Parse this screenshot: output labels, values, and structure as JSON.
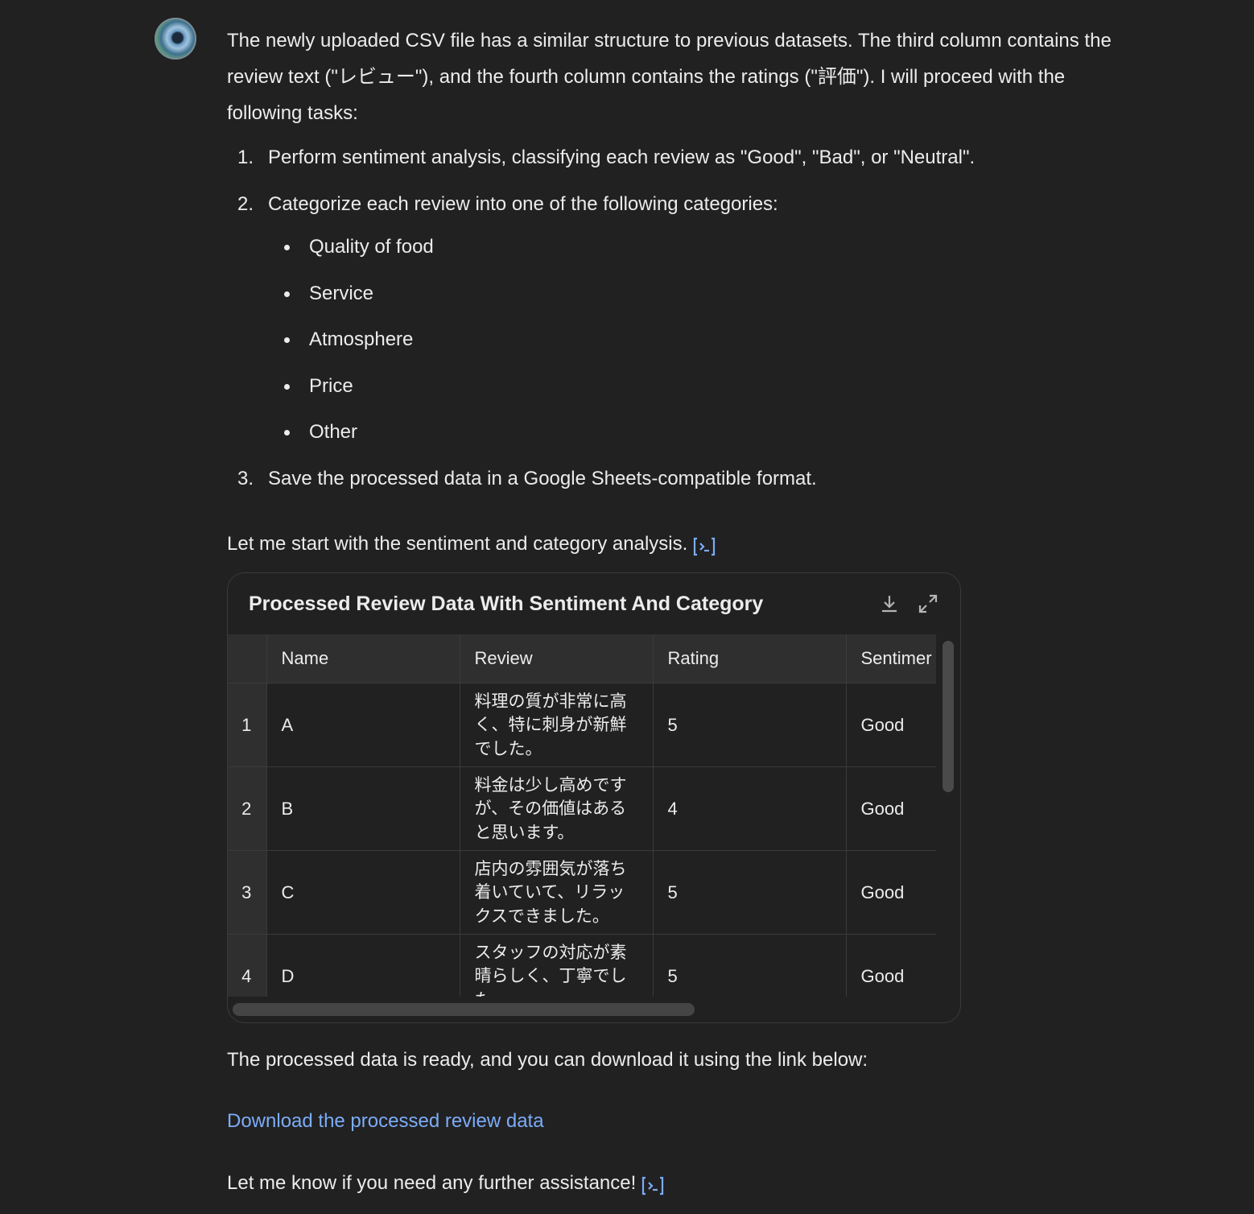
{
  "assistant": {
    "avatar_icon": "assistant-avatar-icon"
  },
  "message": {
    "intro": "The newly uploaded CSV file has a similar structure to previous datasets. The third column contains the review text (\"レビュー\"), and the fourth column contains the ratings (\"評価\"). I will proceed with the following tasks:",
    "tasks": [
      {
        "num": "1.",
        "text": "Perform sentiment analysis, classifying each review as \"Good\", \"Bad\", or \"Neutral\"."
      },
      {
        "num": "2.",
        "text": "Categorize each review into one of the following categories:"
      },
      {
        "num": "3.",
        "text": "Save the processed data in a Google Sheets-compatible format."
      }
    ],
    "categories": [
      "Quality of food",
      "Service",
      "Atmosphere",
      "Price",
      "Other"
    ],
    "start_text": "Let me start with the sentiment and category analysis.",
    "ready_text": "The processed data is ready, and you can download it using the link below:",
    "download_link": "Download the processed review data",
    "closing_text": "Let me know if you need any further assistance!",
    "link_color": "#7cacf8"
  },
  "table_card": {
    "title": "Processed Review Data With Sentiment And Category",
    "download_icon": "download-icon",
    "expand_icon": "expand-icon",
    "columns": [
      "",
      "Name",
      "Review",
      "Rating",
      "Sentimer"
    ],
    "rows": [
      {
        "index": "1",
        "name": "A",
        "review": "料理の質が非常に高く、特に刺身が新鮮でした。",
        "rating": "5",
        "sentiment": "Good"
      },
      {
        "index": "2",
        "name": "B",
        "review": "料金は少し高めですが、その価値はあると思います。",
        "rating": "4",
        "sentiment": "Good"
      },
      {
        "index": "3",
        "name": "C",
        "review": "店内の雰囲気が落ち着いていて、リラックスできました。",
        "rating": "5",
        "sentiment": "Good"
      },
      {
        "index": "4",
        "name": "D",
        "review": "スタッフの対応が素晴らしく、丁寧でした。",
        "rating": "5",
        "sentiment": "Good"
      }
    ]
  }
}
